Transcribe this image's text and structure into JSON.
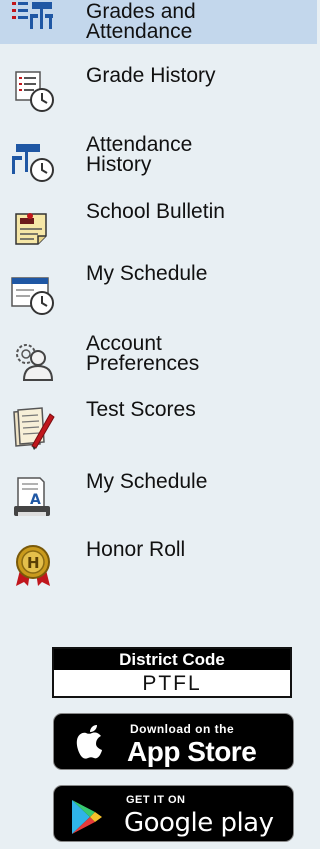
{
  "nav": {
    "items": [
      {
        "label_lines": [
          "Grades and",
          "Attendance"
        ],
        "icon": "grades-attendance-icon",
        "active": true
      },
      {
        "label_lines": [
          "Grade History"
        ],
        "icon": "grade-history-icon"
      },
      {
        "label_lines": [
          "Attendance",
          "History"
        ],
        "icon": "attendance-history-icon"
      },
      {
        "label_lines": [
          "School Bulletin"
        ],
        "icon": "bulletin-icon"
      },
      {
        "label_lines": [
          "My Schedule"
        ],
        "icon": "schedule-icon"
      },
      {
        "label_lines": [
          "Account",
          "Preferences"
        ],
        "icon": "account-preferences-icon"
      },
      {
        "label_lines": [
          "Test Scores"
        ],
        "icon": "test-scores-icon"
      },
      {
        "label_lines": [
          "My Schedule"
        ],
        "icon": "print-schedule-icon"
      },
      {
        "label_lines": [
          "Honor Roll"
        ],
        "icon": "honor-roll-medal-icon"
      }
    ]
  },
  "district": {
    "title": "District Code",
    "value": "PTFL"
  },
  "appstore": {
    "small": "Download on the",
    "big": "App Store",
    "icon": "apple-icon"
  },
  "googleplay": {
    "small": "GET IT ON",
    "big": "Google play",
    "icon": "google-play-icon"
  },
  "colors": {
    "active_bg": "#c3d7ec",
    "sidebar_bg": "#e8eff3",
    "icon_blue": "#1f57a4",
    "medal_gold": "#c99a1c",
    "ribbon_red": "#c0161c"
  }
}
